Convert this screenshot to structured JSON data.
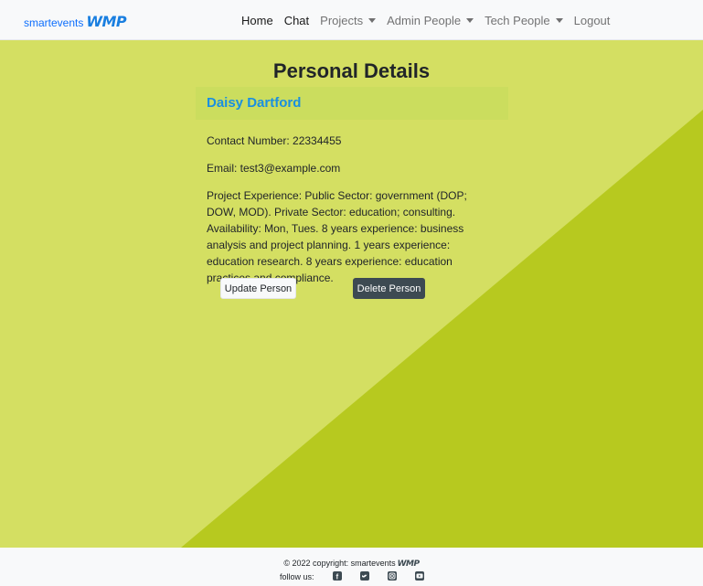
{
  "brand": {
    "small_a": "smart",
    "small_b": "events",
    "big": "WMP"
  },
  "nav": {
    "home": "Home",
    "chat": "Chat",
    "projects": "Projects",
    "admin_people": "Admin People",
    "tech_people": "Tech People",
    "logout": "Logout"
  },
  "page": {
    "title": "Personal Details",
    "person_name": "Daisy Dartford",
    "contact": "Contact Number: 22334455",
    "email": "Email: test3@example.com",
    "experience": "Project Experience: Public Sector: government (DOP; DOW, MOD). Private Sector: education; consulting. Availability: Mon, Tues. 8 years experience: business analysis and project planning. 1 years experience: education research. 8 years experience: education practices and compliance.",
    "update_button": "Update Person",
    "delete_button": "Delete Person"
  },
  "footer": {
    "copyright": "© 2022 copyright: smartevents",
    "brand_big": "WMP",
    "follow": "follow us:",
    "social_icons": [
      "facebook-icon",
      "twitter-icon",
      "instagram-icon",
      "youtube-icon"
    ]
  },
  "colors": {
    "background_light": "#d4df62",
    "background_dark": "#b7c91f",
    "accent": "#1a8fe0",
    "button_dark": "#3d4a52"
  }
}
